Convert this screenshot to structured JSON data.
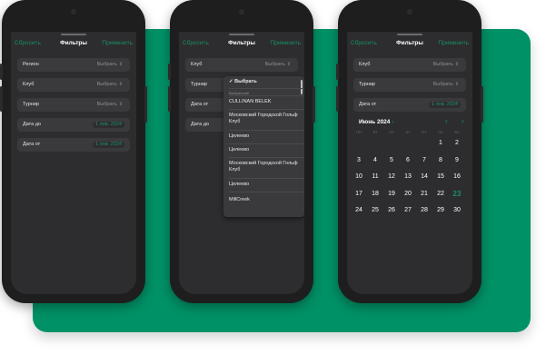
{
  "colors": {
    "brand_green": "#009166",
    "accent_green": "#1a8f62",
    "screen_bg": "#2d2d2f",
    "row_bg": "#3a3a3d"
  },
  "header": {
    "reset": "Сбросить",
    "title": "Фильтры",
    "apply": "Применить"
  },
  "phone1": {
    "rows": [
      {
        "label": "Регион",
        "value": "Выбрать"
      },
      {
        "label": "Клуб",
        "value": "Выбрать"
      },
      {
        "label": "Турнир",
        "value": "Выбрать"
      },
      {
        "label": "Дата до",
        "value": "1 янв. 2024"
      },
      {
        "label": "Дата от",
        "value": "1 янв. 2024"
      }
    ]
  },
  "phone2": {
    "rows": [
      {
        "label": "Клуб",
        "value": "Выбрать"
      },
      {
        "label": "Турнир"
      },
      {
        "label": "Дата от"
      },
      {
        "label": "Дата до"
      }
    ],
    "dropdown": {
      "selected": "Выбрать",
      "section": "Выбранный",
      "items": [
        "CULLINAN BELEK",
        "Московский Городской Гольф Клуб",
        "Целеево",
        "Целеево",
        "Московский Городской Гольф Клуб",
        "Целеево",
        "MillCreek"
      ]
    }
  },
  "phone3": {
    "rows": [
      {
        "label": "Клуб",
        "value": "Выбрать"
      },
      {
        "label": "Турнир",
        "value": "Выбрать"
      },
      {
        "label": "Дата от",
        "value": "1 янв. 2024"
      }
    ],
    "calendar": {
      "month": "Июнь 2024",
      "month_chevron": "›",
      "prev": "‹",
      "next": "›",
      "weekdays": [
        "ПН",
        "ВТ",
        "СР",
        "ЧТ",
        "ПТ",
        "СБ",
        "ВС"
      ],
      "weeks": [
        [
          "",
          "",
          "",
          "",
          "",
          "1",
          "2"
        ],
        [
          "3",
          "4",
          "5",
          "6",
          "7",
          "8",
          "9"
        ],
        [
          "10",
          "11",
          "12",
          "13",
          "14",
          "15",
          "16"
        ],
        [
          "17",
          "18",
          "19",
          "20",
          "21",
          "22",
          "23"
        ],
        [
          "24",
          "25",
          "26",
          "27",
          "28",
          "29",
          "30"
        ]
      ],
      "selected_day": "23"
    }
  },
  "icons": {
    "chevron": "chevron-updown-icon",
    "checkmark": "checkmark-icon"
  }
}
